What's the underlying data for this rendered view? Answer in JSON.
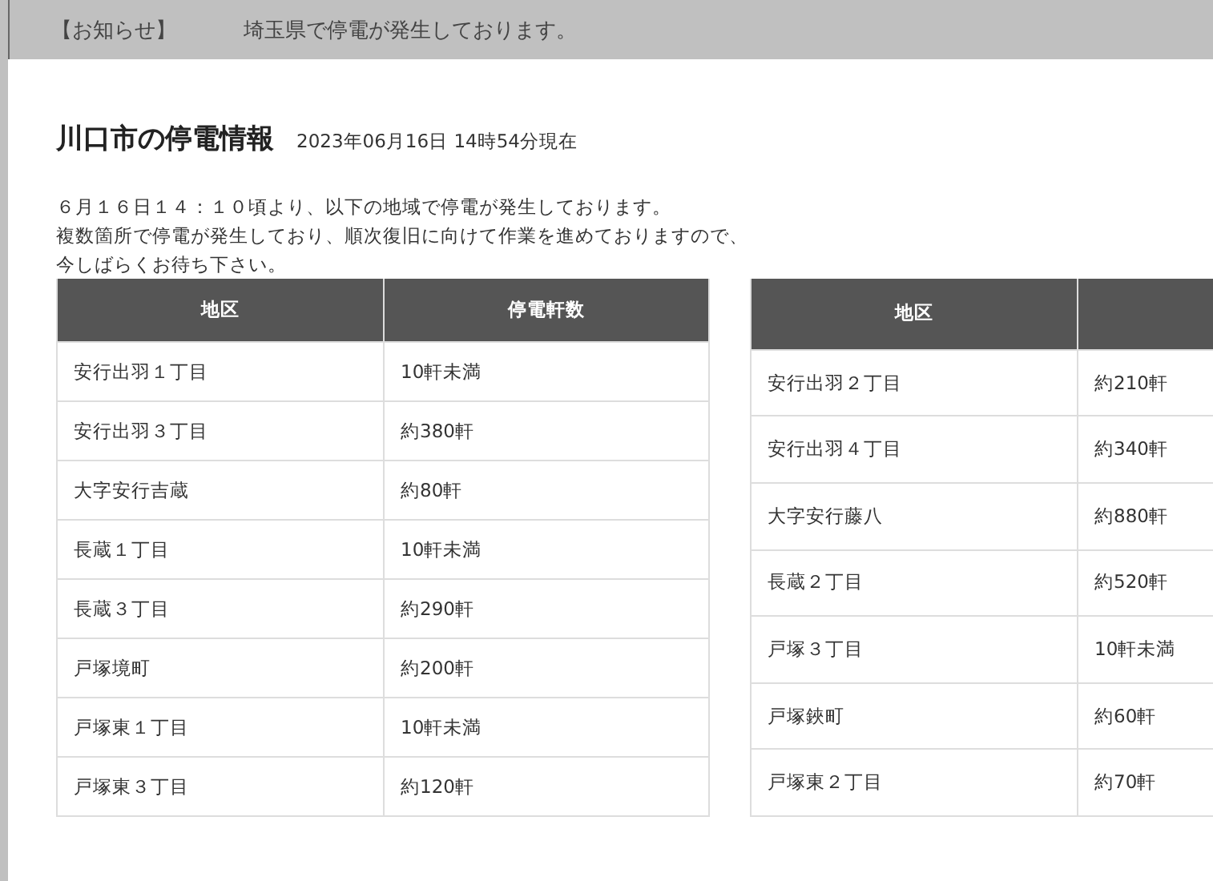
{
  "notice": {
    "label": "【お知らせ】",
    "message": "埼玉県で停電が発生しております。"
  },
  "heading": {
    "title": "川口市の停電情報",
    "timestamp": "2023年06月16日 14時54分現在"
  },
  "description": [
    "６月１６日１４：１０頃より、以下の地域で停電が発生しております。",
    "複数箇所で停電が発生しており、順次復旧に向けて作業を進めておりますので、",
    "今しばらくお待ち下さい。"
  ],
  "tables": [
    {
      "columns": [
        "地区",
        "停電軒数"
      ],
      "rows": [
        [
          "安行出羽１丁目",
          "10軒未満"
        ],
        [
          "安行出羽３丁目",
          "約380軒"
        ],
        [
          "大字安行吉蔵",
          "約80軒"
        ],
        [
          "長蔵１丁目",
          "10軒未満"
        ],
        [
          "長蔵３丁目",
          "約290軒"
        ],
        [
          "戸塚境町",
          "約200軒"
        ],
        [
          "戸塚東１丁目",
          "10軒未満"
        ],
        [
          "戸塚東３丁目",
          "約120軒"
        ]
      ]
    },
    {
      "columns": [
        "地区"
      ],
      "rows": [
        [
          "安行出羽２丁目",
          "約210軒"
        ],
        [
          "安行出羽４丁目",
          "約340軒"
        ],
        [
          "大字安行藤八",
          "約880軒"
        ],
        [
          "長蔵２丁目",
          "約520軒"
        ],
        [
          "戸塚３丁目",
          "10軒未満"
        ],
        [
          "戸塚鋏町",
          "約60軒"
        ],
        [
          "戸塚東２丁目",
          "約70軒"
        ]
      ]
    }
  ]
}
